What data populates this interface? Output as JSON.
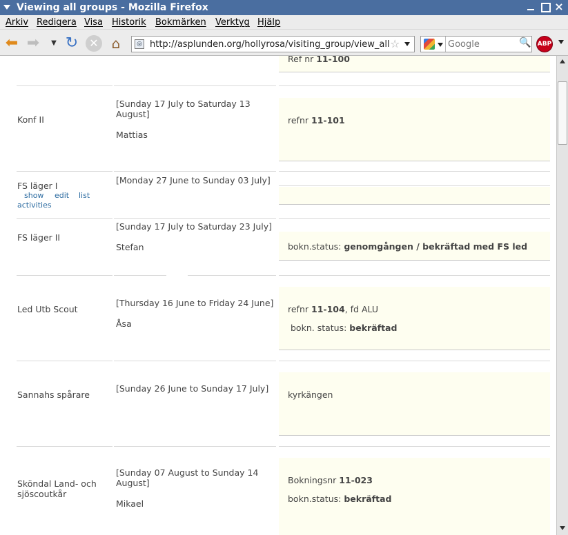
{
  "window": {
    "title": "Viewing all groups - Mozilla Firefox",
    "close_glyph": "×"
  },
  "menu": {
    "items": [
      "Arkiv",
      "Redigera",
      "Visa",
      "Historik",
      "Bokmärken",
      "Verktyg",
      "Hjälp"
    ]
  },
  "nav": {
    "url": "http://asplunden.org/hollyrosa/visiting_group/view_all",
    "search_placeholder": "Google",
    "adblock_label": "ABP",
    "back_icon": "back-arrow-icon",
    "forward_icon": "forward-arrow-icon",
    "reload_icon": "reload-icon",
    "stop_icon": "stop-icon",
    "home_icon": "home-icon"
  },
  "groups": [
    {
      "name": "",
      "dates": "",
      "contact": "",
      "note": [
        {
          "label": "Ref nr",
          "value": "11-100"
        }
      ]
    },
    {
      "name": "Konf II",
      "dates_line1": "[Sunday 17 July to Saturday 13",
      "dates_line2": "August]",
      "contact": "Mattias",
      "note": [
        {
          "label": "refnr",
          "value": "11-101"
        }
      ]
    },
    {
      "name": "FS läger I",
      "links": [
        "show",
        "edit",
        "list",
        "activities"
      ],
      "dates": "[Monday 27 June to Sunday 03 July]",
      "contact": "",
      "note": []
    },
    {
      "name": "FS läger II",
      "dates": "[Sunday 17 July to Saturday 23 July]",
      "contact": "Stefan",
      "note": [
        {
          "label": "bokn.status:",
          "value": "genomgången / bekräftad med FS led"
        }
      ]
    },
    {
      "name": "Led Utb Scout",
      "dates": "[Thursday 16 June to Friday 24 June]",
      "contact": "Åsa",
      "note": [
        {
          "label": "refnr",
          "value": "11-104",
          "suffix": ", fd ALU"
        },
        {
          "label": "bokn. status:",
          "value": "bekräftad"
        }
      ]
    },
    {
      "name": "Sannahs spårare",
      "dates": "[Sunday 26 June to Sunday 17 July]",
      "contact": "",
      "note": [
        {
          "label": "kyrkängen",
          "value": ""
        }
      ]
    },
    {
      "name_line1": "Sköndal Land- och",
      "name_line2": "sjöscoutkår",
      "dates_line1": "[Sunday 07 August to Sunday 14",
      "dates_line2": "August]",
      "contact": "Mikael",
      "note": [
        {
          "label": "Bokningsnr",
          "value": "11-023"
        },
        {
          "label": "bokn.status:",
          "value": "bekräftad"
        }
      ]
    }
  ]
}
